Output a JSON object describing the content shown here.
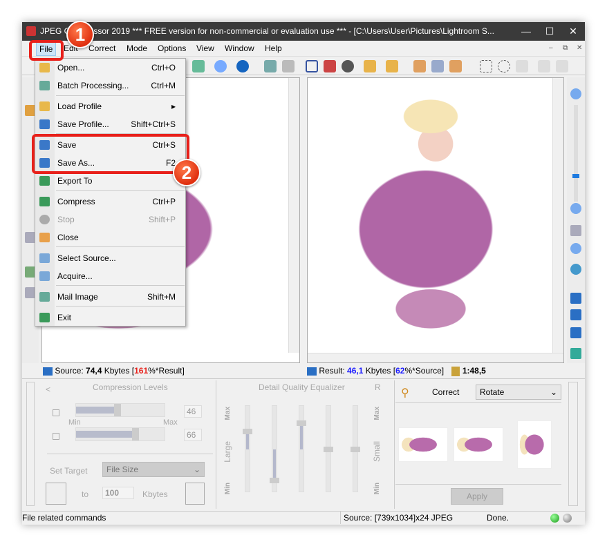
{
  "window": {
    "title": "JPEG Compressor 2019   *** FREE version for non-commercial or evaluation use *** - [C:\\Users\\User\\Pictures\\Lightroom S...",
    "min": "—",
    "max": "☐",
    "close": "✕"
  },
  "menu": [
    "File",
    "Edit",
    "Correct",
    "Mode",
    "Options",
    "View",
    "Window",
    "Help"
  ],
  "mdi": {
    "min": "–",
    "restore": "⧉",
    "close": "✕"
  },
  "file_menu": [
    {
      "label": "Open...",
      "shortcut": "Ctrl+O"
    },
    {
      "label": "Batch Processing...",
      "shortcut": "Ctrl+M"
    },
    {
      "label": "Load Profile",
      "shortcut": "▸"
    },
    {
      "label": "Save Profile...",
      "shortcut": "Shift+Ctrl+S"
    },
    {
      "label": "Save",
      "shortcut": "Ctrl+S"
    },
    {
      "label": "Save As...",
      "shortcut": "F2"
    },
    {
      "label": "Export To",
      "shortcut": ""
    },
    {
      "label": "Compress",
      "shortcut": "Ctrl+P"
    },
    {
      "label": "Stop",
      "shortcut": "Shift+P"
    },
    {
      "label": "Close",
      "shortcut": ""
    },
    {
      "label": "Select Source...",
      "shortcut": ""
    },
    {
      "label": "Acquire...",
      "shortcut": ""
    },
    {
      "label": "Mail Image",
      "shortcut": "Shift+M"
    },
    {
      "label": "Exit",
      "shortcut": ""
    }
  ],
  "badges": [
    "1",
    "2"
  ],
  "source_info": {
    "prefix": "Source: ",
    "size": "74,4",
    "unit": " Kbytes  [",
    "pct": "161",
    "suffix": "%*Result]"
  },
  "result_info": {
    "prefix": "Result: ",
    "size": "46,1",
    "unit": " Kbytes  [",
    "pct": "62",
    "suffix": "%*Source]",
    "ratio": "1:48,5"
  },
  "compression": {
    "title": "Compression Levels",
    "back": "<",
    "min": "Min",
    "max": "Max",
    "level1": 46,
    "level2": 66,
    "value1": "46",
    "value2": "66"
  },
  "target": {
    "label": "Set Target",
    "mode": "File Size",
    "to": "to",
    "value": "100",
    "unit": "Kbytes"
  },
  "equalizer": {
    "title": "Detail Quality Equalizer",
    "r": "R",
    "max": "Max",
    "min": "Min",
    "large": "Large",
    "small": "Small",
    "values": [
      0.72,
      0.12,
      0.82,
      0.5,
      0.5
    ]
  },
  "correct": {
    "label": "Correct",
    "mode": "Rotate",
    "apply": "Apply"
  },
  "status": {
    "hint": "File related commands",
    "source": "Source: [739x1034]x24 JPEG",
    "state": "Done."
  },
  "colors": {
    "accent_red": "#e8201a",
    "highlight_blue": "#1a1aff",
    "title_bg": "#3a3a3a"
  }
}
